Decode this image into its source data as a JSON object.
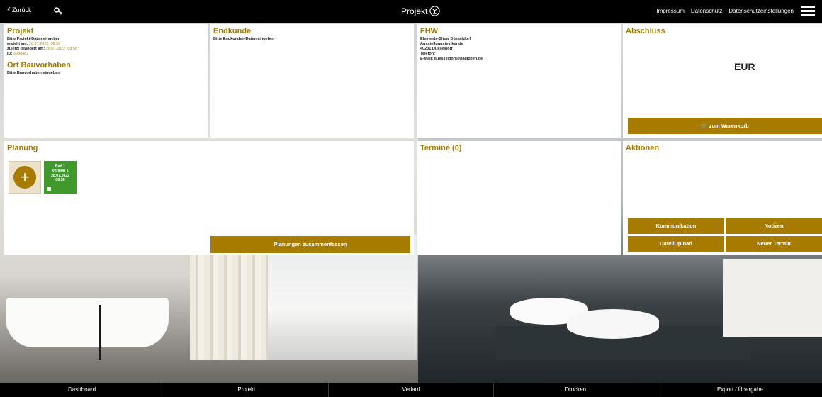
{
  "topbar": {
    "back_label": "Zurück",
    "title": "Projekt",
    "links": [
      "Impressum",
      "Datenschutz",
      "Datenschutzeinstellungen"
    ]
  },
  "projekt": {
    "title": "Projekt",
    "line1": "Bitte Projekt-Daten eingeben",
    "created_label": "erstellt am:",
    "created_value": "28.07.2022, 08:56",
    "changed_label": "zuletzt geändert am:",
    "changed_value": "28.07.2022, 08:56",
    "id_label": "ID:",
    "id_value": "3938482",
    "ort_title": "Ort Bauvorhaben",
    "ort_text": "Bitte Bauvorhaben eingeben"
  },
  "endkunde": {
    "title": "Endkunde",
    "text": "Bitte Endkunden-Daten eingeben"
  },
  "fhw": {
    "title": "FHW",
    "lines": [
      "Elements-Show Düsseldorf",
      "Ausstellungstestkunde",
      "40231 Düsseldorf",
      "Telefon:",
      "E-Mail: duesseldorf@badideen.de"
    ]
  },
  "abschluss": {
    "title": "Abschluss",
    "currency": "EUR",
    "cart_button": "zum Warenkorb"
  },
  "planung": {
    "title": "Planung",
    "card_lines": [
      "Bad 1",
      "Version 1",
      "28.07.2022",
      "08:56"
    ],
    "merge_button": "Planungen zusammenfassen"
  },
  "termine": {
    "title": "Termine (0)"
  },
  "aktionen": {
    "title": "Aktionen",
    "buttons": [
      "Kommunikation",
      "Notizen",
      "Datei/Upload",
      "Neuer Termin"
    ]
  },
  "bottom_nav": [
    "Dashboard",
    "Projekt",
    "Verlauf",
    "Drucken",
    "Export / Übergabe"
  ],
  "colors": {
    "accent": "#a67b00",
    "plan_green": "#3f9a2b",
    "bar": "#000000"
  }
}
